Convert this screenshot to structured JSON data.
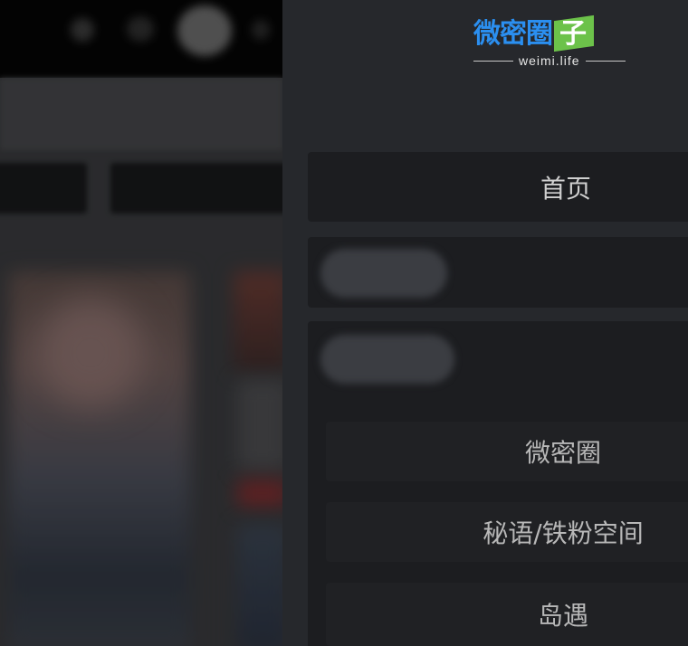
{
  "logo": {
    "brand_text": "微密圈",
    "brand_flag_char": "子",
    "url": "weimi.life",
    "colors": {
      "blue": "#2b8ff0",
      "green": "#6cc24a"
    }
  },
  "menu": {
    "home_label": "首页",
    "submenu": [
      {
        "label": "微密圈"
      },
      {
        "label": "秘语/铁粉空间"
      },
      {
        "label": "岛遇"
      }
    ]
  },
  "colors": {
    "drawer_bg": "#26282c",
    "item_bg": "#1c1d20",
    "text": "#cfcfcf"
  }
}
